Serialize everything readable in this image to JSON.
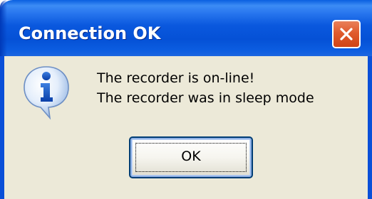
{
  "dialog": {
    "title": "Connection OK",
    "icon": "information-icon",
    "message_line1": "The recorder is on-line!",
    "message_line2": "The recorder was in sleep mode",
    "ok_label": "OK",
    "close_icon": "close-icon"
  },
  "colors": {
    "titlebar": "#0a58de",
    "client_background": "#ece9d8",
    "close_button": "#e05b2e",
    "button_border": "#003c74"
  }
}
